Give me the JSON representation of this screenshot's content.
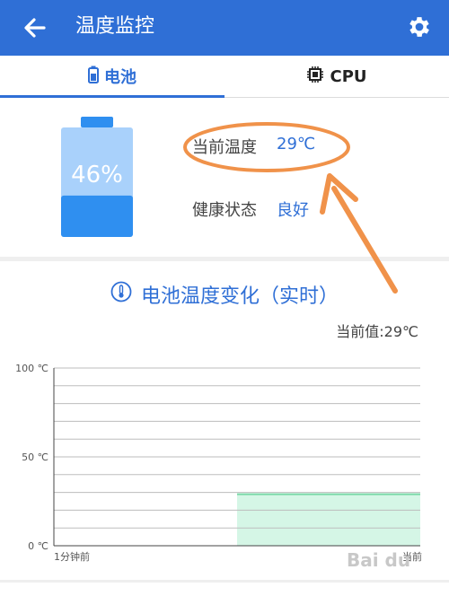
{
  "header": {
    "title": "温度监控",
    "back_icon": "arrow-left-icon",
    "settings_icon": "gear-icon",
    "bg_color": "#2f6fd6"
  },
  "tabs": [
    {
      "label": "电池",
      "icon": "battery-icon",
      "active": true
    },
    {
      "label": "CPU",
      "icon": "chip-icon",
      "active": false
    }
  ],
  "battery": {
    "percent_label": "46%",
    "level": 0.46
  },
  "info": {
    "temp_label": "当前温度",
    "temp_value": "29℃",
    "health_label": "健康状态",
    "health_value": "良好"
  },
  "chart_section": {
    "title": "电池温度变化（实时）",
    "current_value": "当前值:29℃",
    "icon": "thermometer-icon"
  },
  "chart_data": {
    "type": "area",
    "title": "电池温度变化（实时）",
    "y_ticks": [
      "100 ℃",
      "50 ℃",
      "0 ℃"
    ],
    "x_ticks": [
      "1分钟前",
      "当前"
    ],
    "ylim": [
      0,
      100
    ],
    "series": [
      {
        "x": [
          0.5,
          1.0
        ],
        "values": [
          29,
          29
        ]
      }
    ],
    "fill_color": "#d5f6e6",
    "line_color": "#7ad9a8",
    "grid": true
  },
  "watermark": "Bai du"
}
